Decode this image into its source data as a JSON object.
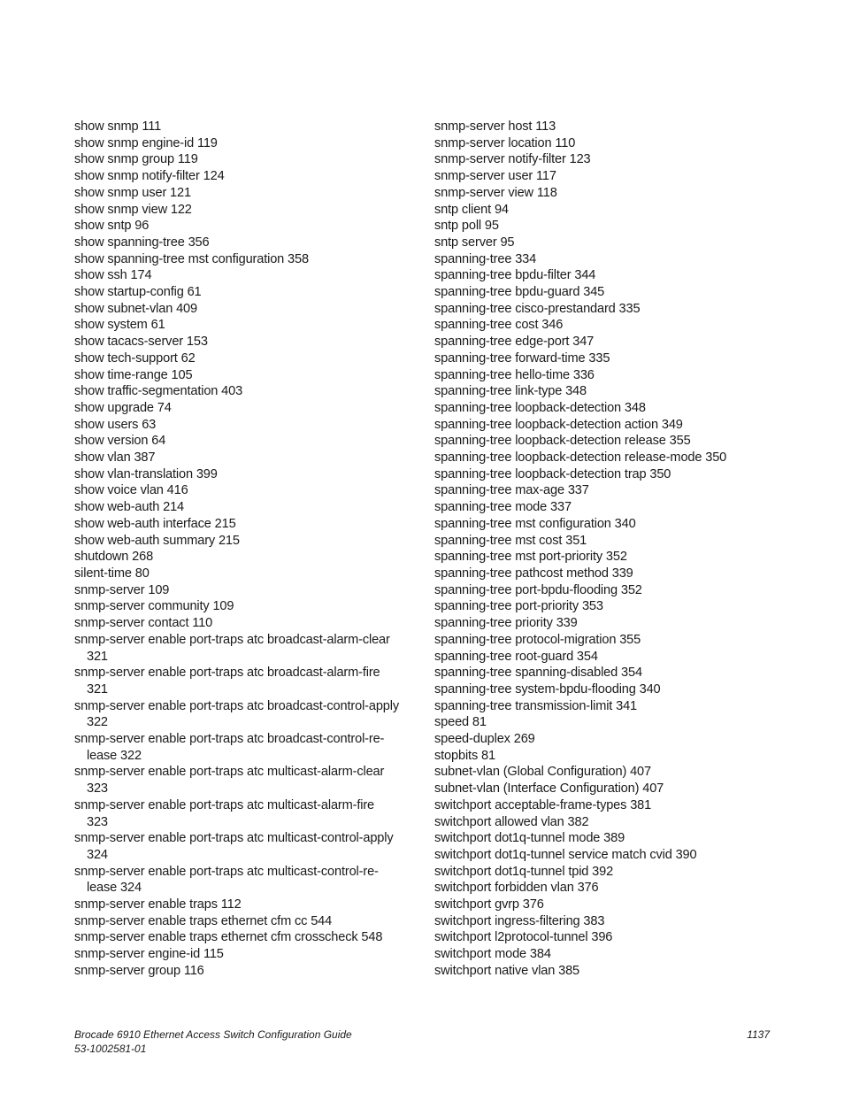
{
  "index": {
    "left_column": [
      "show snmp 111",
      "show snmp engine-id 119",
      "show snmp group 119",
      "show snmp notify-filter 124",
      "show snmp user 121",
      "show snmp view 122",
      "show sntp 96",
      "show spanning-tree 356",
      "show spanning-tree mst configuration 358",
      "show ssh 174",
      "show startup-config 61",
      "show subnet-vlan 409",
      "show system 61",
      "show tacacs-server 153",
      "show tech-support 62",
      "show time-range 105",
      "show traffic-segmentation 403",
      "show upgrade 74",
      "show users 63",
      "show version 64",
      "show vlan 387",
      "show vlan-translation 399",
      "show voice vlan 416",
      "show web-auth 214",
      "show web-auth interface 215",
      "show web-auth summary 215",
      "shutdown 268",
      "silent-time 80",
      "snmp-server 109",
      "snmp-server community 109",
      "snmp-server contact 110",
      "snmp-server enable port-traps atc broadcast-alarm-clear\n321",
      "snmp-server enable port-traps atc broadcast-alarm-fire\n321",
      "snmp-server enable port-traps atc broadcast-control-apply\n322",
      "snmp-server enable port-traps atc broadcast-control-re-\nlease 322",
      "snmp-server enable port-traps atc multicast-alarm-clear\n323",
      "snmp-server enable port-traps atc multicast-alarm-fire\n323",
      "snmp-server enable port-traps atc multicast-control-apply\n324",
      "snmp-server enable port-traps atc multicast-control-re-\nlease 324",
      "snmp-server enable traps 112",
      "snmp-server enable traps ethernet cfm cc 544",
      "snmp-server enable traps ethernet cfm crosscheck 548",
      "snmp-server engine-id 115",
      "snmp-server group 116"
    ],
    "right_column": [
      "snmp-server host  113",
      "snmp-server location 110",
      "snmp-server notify-filter 123",
      "snmp-server user 117",
      "snmp-server view 118",
      "sntp client 94",
      "sntp poll 95",
      "sntp server 95",
      "spanning-tree 334",
      "spanning-tree bpdu-filter 344",
      "spanning-tree bpdu-guard 345",
      "spanning-tree cisco-prestandard 335",
      "spanning-tree cost 346",
      "spanning-tree edge-port 347",
      "spanning-tree forward-time 335",
      "spanning-tree hello-time 336",
      "spanning-tree link-type 348",
      "spanning-tree loopback-detection 348",
      "spanning-tree loopback-detection action 349",
      "spanning-tree loopback-detection release 355",
      "spanning-tree loopback-detection release-mode 350",
      "spanning-tree loopback-detection trap 350",
      "spanning-tree max-age 337",
      "spanning-tree mode 337",
      "spanning-tree mst configuration 340",
      "spanning-tree mst cost 351",
      "spanning-tree mst port-priority 352",
      "spanning-tree pathcost method 339",
      "spanning-tree port-bpdu-flooding 352",
      "spanning-tree port-priority 353",
      "spanning-tree priority 339",
      "spanning-tree protocol-migration 355",
      "spanning-tree root-guard 354",
      "spanning-tree spanning-disabled 354",
      "spanning-tree system-bpdu-flooding 340",
      "spanning-tree transmission-limit 341",
      "speed 81",
      "speed-duplex 269",
      "stopbits 81",
      "subnet-vlan (Global Configuration) 407",
      "subnet-vlan (Interface Configuration) 407",
      "switchport acceptable-frame-types  381",
      "switchport allowed vlan 382",
      "switchport dot1q-tunnel mode 389",
      "switchport dot1q-tunnel service match cvid 390",
      "switchport dot1q-tunnel tpid 392",
      "switchport forbidden vlan 376",
      "switchport gvrp 376",
      "switchport ingress-filtering  383",
      "switchport l2protocol-tunnel  396",
      "switchport mode 384",
      "switchport native vlan 385"
    ]
  },
  "footer": {
    "title": "Brocade 6910 Ethernet Access Switch Configuration Guide",
    "doc_number": "53-1002581-01",
    "page_number": "1137"
  }
}
